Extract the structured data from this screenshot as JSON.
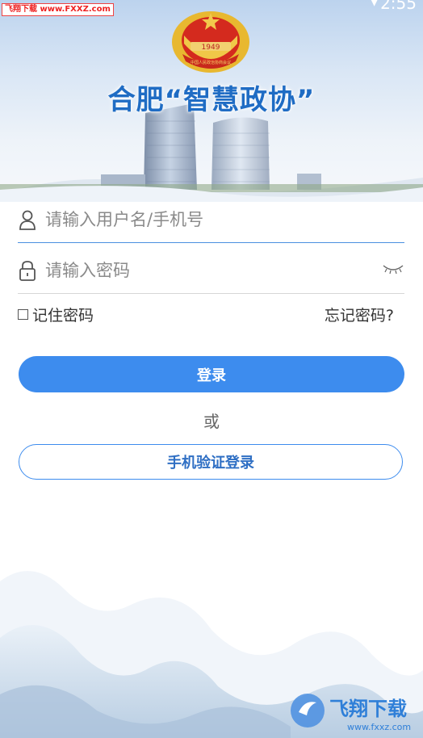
{
  "status_bar": {
    "time": "2:55"
  },
  "watermark_top": "飞翔下载 www.FXXZ.com",
  "header": {
    "emblem_year": "1949",
    "emblem_ribbon": "中国人民政治协商会议",
    "title": "合肥“智慧政协”"
  },
  "form": {
    "username_placeholder": "请输入用户名/手机号",
    "password_placeholder": "请输入密码",
    "remember_label": "记住密码",
    "forgot_label": "忘记密码?",
    "login_label": "登录",
    "or_text": "或",
    "sms_login_label": "手机验证登录"
  },
  "watermark_bottom": {
    "text": "飞翔下载",
    "url": "www.fxxz.com"
  },
  "colors": {
    "primary": "#3d8cee",
    "title": "#1f6cc4"
  },
  "icons": [
    "user-icon",
    "lock-icon",
    "eye-closed-icon"
  ]
}
